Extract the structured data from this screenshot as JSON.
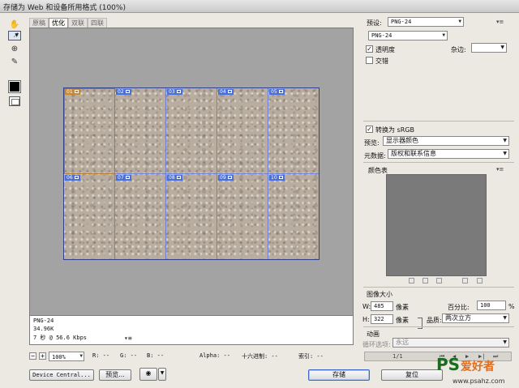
{
  "window": {
    "title": "存储为 Web 和设备所用格式 (100%)"
  },
  "tabs": [
    {
      "label": "原稿",
      "active": false
    },
    {
      "label": "优化",
      "active": true
    },
    {
      "label": "双联",
      "active": false
    },
    {
      "label": "四联",
      "active": false
    }
  ],
  "tools": [
    {
      "name": "hand-tool-icon",
      "glyph": "✋"
    },
    {
      "name": "slice-select-tool-icon",
      "glyph": "⟋"
    },
    {
      "name": "zoom-tool-icon",
      "glyph": "🔍"
    },
    {
      "name": "eyedropper-tool-icon",
      "glyph": "✎"
    }
  ],
  "eyedropper_color": "#000000",
  "slices": {
    "top_labels": [
      "01",
      "02",
      "03",
      "04",
      "05"
    ],
    "bottom_labels": [
      "06",
      "07",
      "08",
      "09",
      "10"
    ]
  },
  "info": {
    "format": "PNG-24",
    "size": "34.96K",
    "time": "7 秒 @ 56.6 Kbps",
    "menu_icon": "▾≡"
  },
  "status": {
    "zoom_minus": "−",
    "zoom_plus": "+",
    "zoom": "100%",
    "r": "R: --",
    "g": "G: --",
    "b": "B: --",
    "alpha": "Alpha: --",
    "hex": "十六进制: --",
    "index": "索引: --"
  },
  "buttons": {
    "device_central": "Device Central...",
    "preview": "预览...",
    "save": "存储",
    "reset": "复位"
  },
  "preset": {
    "label": "预设:",
    "value": "PNG-24",
    "format": "PNG-24",
    "transparency_label": "透明度",
    "transparency_checked": true,
    "interlace_label": "交错",
    "interlace_checked": false,
    "matte_label": "杂边:",
    "matte_value": ""
  },
  "convert_srgb": {
    "label": "转换为 sRGB",
    "checked": true
  },
  "preview_select": {
    "label": "预览:",
    "value": "显示器颜色"
  },
  "metadata": {
    "label": "元数据:",
    "value": "版权和联系信息"
  },
  "color_table": {
    "title": "颜色表"
  },
  "image_size": {
    "title": "图像大小",
    "w_label": "W:",
    "w_value": "485",
    "h_label": "H:",
    "h_value": "322",
    "unit": "像素",
    "percent_label": "百分比:",
    "percent_value": "100",
    "percent_unit": "%",
    "quality_label": "品质:",
    "quality_value": "两次立方"
  },
  "animation": {
    "title": "动画",
    "loop_label": "循环选项:",
    "loop_value": "永远",
    "frame": "1/1"
  },
  "watermark": {
    "ps": "PS",
    "cn": "爱好者",
    "url": "www.psahz.com"
  }
}
